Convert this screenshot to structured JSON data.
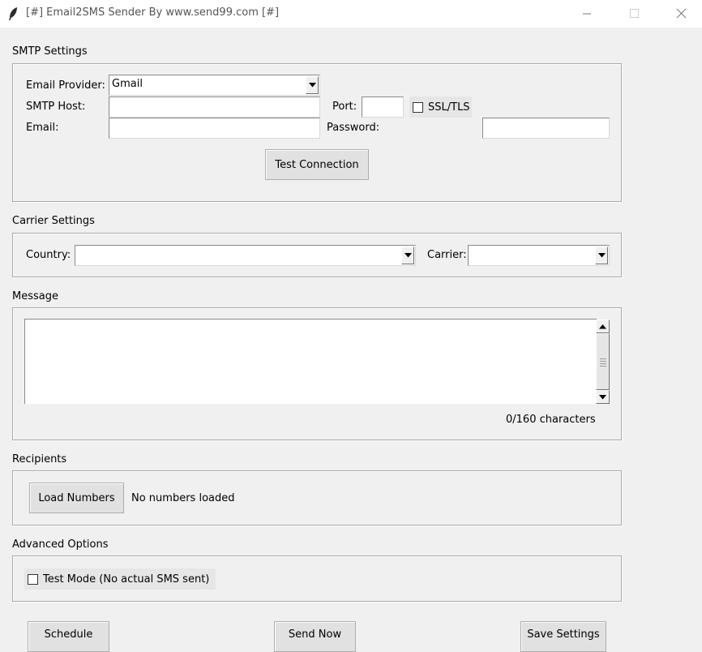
{
  "window": {
    "title": "[#] Email2SMS Sender By www.send99.com [#]",
    "icon": "feather-icon"
  },
  "smtp": {
    "section_title": "SMTP Settings",
    "provider_label": "Email Provider:",
    "provider_value": "Gmail",
    "host_label": "SMTP Host:",
    "host_value": "",
    "port_label": "Port:",
    "port_value": "",
    "ssl_label": "SSL/TLS",
    "ssl_checked": false,
    "email_label": "Email:",
    "email_value": "",
    "password_label": "Password:",
    "password_value": "",
    "test_button": "Test Connection"
  },
  "carrier": {
    "section_title": "Carrier Settings",
    "country_label": "Country:",
    "country_value": "",
    "carrier_label": "Carrier:",
    "carrier_value": ""
  },
  "message": {
    "section_title": "Message",
    "body": "",
    "counter": "0/160 characters"
  },
  "recipients": {
    "section_title": "Recipients",
    "load_button": "Load Numbers",
    "status": "No numbers loaded"
  },
  "advanced": {
    "section_title": "Advanced Options",
    "test_mode_label": "Test Mode (No actual SMS sent)",
    "test_mode_checked": false
  },
  "footer": {
    "schedule_button": "Schedule",
    "send_button": "Send Now",
    "save_button": "Save Settings"
  }
}
